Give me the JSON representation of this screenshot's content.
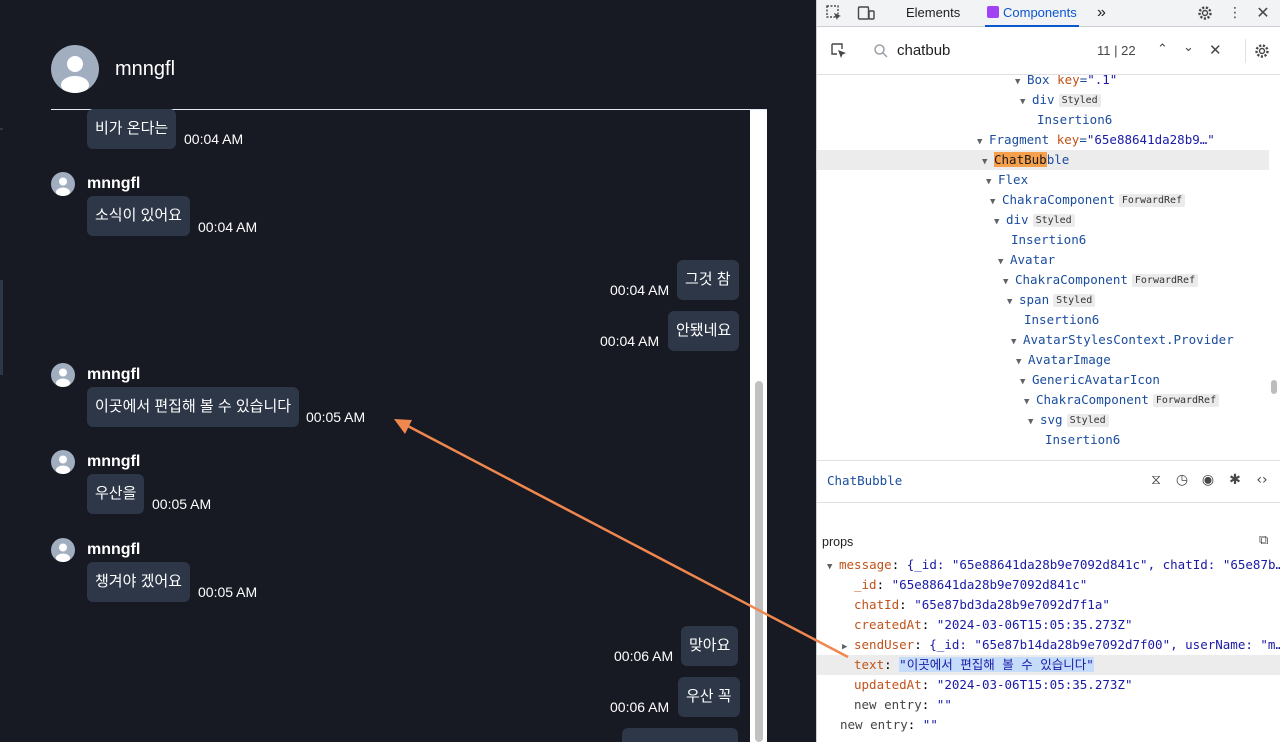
{
  "chat": {
    "header_name": "mnngfl",
    "messages": [
      {
        "side": "left",
        "author": "",
        "text": "비가 온다는",
        "time": "00:04 AM"
      },
      {
        "side": "left",
        "author": "mnngfl",
        "text": "소식이 있어요",
        "time": "00:04 AM"
      },
      {
        "side": "right",
        "author": "",
        "text": "그것 참",
        "time": "00:04 AM"
      },
      {
        "side": "right",
        "author": "",
        "text": "안됐네요",
        "time": "00:04 AM"
      },
      {
        "side": "left",
        "author": "mnngfl",
        "text": "이곳에서 편집해 볼 수 있습니다",
        "time": "00:05 AM"
      },
      {
        "side": "left",
        "author": "mnngfl",
        "text": "우산을",
        "time": "00:05 AM"
      },
      {
        "side": "left",
        "author": "mnngfl",
        "text": "챙겨야 겠어요",
        "time": "00:05 AM"
      },
      {
        "side": "right",
        "author": "",
        "text": "맞아요",
        "time": "00:06 AM"
      },
      {
        "side": "right",
        "author": "",
        "text": "우산 꼭",
        "time": "00:06 AM"
      }
    ]
  },
  "devtools": {
    "tabs": {
      "elements": "Elements",
      "components": "Components",
      "more": "»"
    },
    "search": {
      "query": "chatbub",
      "count": "11 | 22"
    },
    "tree": [
      {
        "name": "Box",
        "key": "\".1\"",
        "badge": "",
        "twisty": "▼"
      },
      {
        "name": "div",
        "key": "",
        "badge": "Styled",
        "twisty": "▼"
      },
      {
        "name": "Insertion6",
        "key": "",
        "badge": "",
        "twisty": ""
      },
      {
        "name": "Fragment",
        "key": "\"65e88641da28b9…\"",
        "badge": "",
        "twisty": "▼"
      },
      {
        "name_hl": "ChatBub",
        "name_rest": "ble",
        "key": "",
        "badge": "",
        "twisty": "▼",
        "selected": true
      },
      {
        "name": "Flex",
        "key": "",
        "badge": "",
        "twisty": "▼"
      },
      {
        "name": "ChakraComponent",
        "key": "",
        "badge": "ForwardRef",
        "twisty": "▼"
      },
      {
        "name": "div",
        "key": "",
        "badge": "Styled",
        "twisty": "▼"
      },
      {
        "name": "Insertion6",
        "key": "",
        "badge": "",
        "twisty": ""
      },
      {
        "name": "Avatar",
        "key": "",
        "badge": "",
        "twisty": "▼"
      },
      {
        "name": "ChakraComponent",
        "key": "",
        "badge": "ForwardRef",
        "twisty": "▼"
      },
      {
        "name": "span",
        "key": "",
        "badge": "Styled",
        "twisty": "▼"
      },
      {
        "name": "Insertion6",
        "key": "",
        "badge": "",
        "twisty": ""
      },
      {
        "name": "AvatarStylesContext.Provider",
        "key": "",
        "badge": "",
        "twisty": "▼"
      },
      {
        "name": "AvatarImage",
        "key": "",
        "badge": "",
        "twisty": "▼"
      },
      {
        "name": "GenericAvatarIcon",
        "key": "",
        "badge": "",
        "twisty": "▼"
      },
      {
        "name": "ChakraComponent",
        "key": "",
        "badge": "ForwardRef",
        "twisty": "▼"
      },
      {
        "name": "svg",
        "key": "",
        "badge": "Styled",
        "twisty": "▼"
      },
      {
        "name": "Insertion6",
        "key": "",
        "badge": "",
        "twisty": ""
      }
    ],
    "selected_component": "ChatBubble",
    "props_label": "props",
    "props": [
      {
        "twisty": "▼",
        "key": "message",
        "value": "{_id: \"65e88641da28b9e7092d841c\", chatId: \"65e87b…"
      },
      {
        "twisty": "",
        "key": "_id",
        "value": "\"65e88641da28b9e7092d841c\""
      },
      {
        "twisty": "",
        "key": "chatId",
        "value": "\"65e87bd3da28b9e7092d7f1a\""
      },
      {
        "twisty": "",
        "key": "createdAt",
        "value": "\"2024-03-06T15:05:35.273Z\""
      },
      {
        "twisty": "▶",
        "key": "sendUser",
        "value": "{_id: \"65e87b14da28b9e7092d7f00\", userName: \"m…"
      },
      {
        "twisty": "",
        "key": "text",
        "value": "\"이곳에서 편집해 볼 수 있습니다\"",
        "selected": true
      },
      {
        "twisty": "",
        "key": "updatedAt",
        "value": "\"2024-03-06T15:05:35.273Z\""
      },
      {
        "twisty": "",
        "key": "new entry",
        "value": "\"\"",
        "plain": true
      },
      {
        "twisty": "",
        "key": "new entry",
        "value": "\"\"",
        "plain": true
      }
    ]
  },
  "annotation": {
    "arrow_color": "#f0874e"
  }
}
